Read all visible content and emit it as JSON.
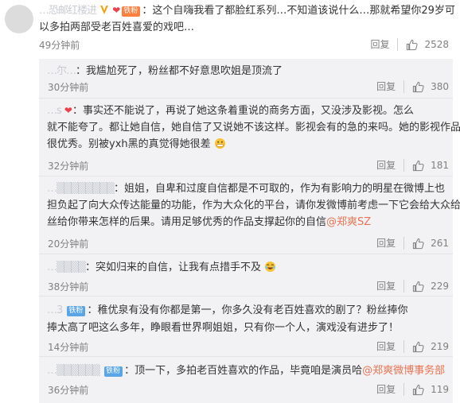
{
  "main_comment": {
    "username": "…恐邮红楼进",
    "badge": "铁粉",
    "text_lines": [
      "：这个自嗨我看了都脸红系列…不知道该说什么…那就希望你29岁可",
      "以多拍两部受老百姓喜爱的戏吧…"
    ],
    "time": "49分钟前",
    "reply_label": "回复",
    "likes": "2528"
  },
  "replies": [
    {
      "username": "…尔…",
      "badge": "",
      "lines": [
        "：我尴尬死了，粉丝都不好意思吹姐是顶流了"
      ],
      "time": "30分钟前",
      "reply_label": "回复",
      "likes": "380"
    },
    {
      "username": "…s",
      "badge": "heart",
      "lines": [
        "：事实还不能说了，再说了她这条着重说的商务方面，又没涉及影视。怎么",
        "就不能夸了。都让她自信，她自信了又说她不该这样。影视会有的急的来吗。她的影视作品也",
        "很优秀。别被yxh黑的真觉得她很差"
      ],
      "time": "32分钟前",
      "reply_label": "回复",
      "likes": "181"
    },
    {
      "username": "…",
      "badge": "",
      "lines": [
        "：姐姐，自卑和过度自信都是不可取的，作为有影响力的明星在微博上也",
        "担负起了向大众传达能量的功能，作为大众化的平台，请你发微博前考虑一下它会给大众给粉",
        "丝给你带来怎样的后果。请用足够优秀的作品支撑起你的自信"
      ],
      "mention": "@郑爽SZ",
      "time": "20分钟前",
      "reply_label": "回复",
      "likes": "261"
    },
    {
      "username": "…",
      "badge": "",
      "lines": [
        "：突如归来的自信，让我有点措手不及"
      ],
      "time": "38分钟前",
      "reply_label": "回复",
      "likes": "229"
    },
    {
      "username": "…3",
      "badge": "铁粉",
      "lines": [
        "：稚优泉有没有你都是第一，你多久没有老百姓喜欢的剧了？粉丝捧你",
        "捧太高了吧这么多年，睁眼看世界啊姐姐，只有你一个人，演戏没有进步了！"
      ],
      "time": "14分钟前",
      "reply_label": "回复",
      "likes": "219"
    },
    {
      "username": "…",
      "badge": "铁粉",
      "lines": [
        "：顶一下，多拍老百姓喜欢的作品，毕竟咱是演员哈"
      ],
      "mention": "@郑爽微博事务部",
      "time": "36分钟前",
      "reply_label": "回复",
      "likes": "119"
    }
  ],
  "colors": {
    "link": "#eb7350",
    "reply_bg": "#f2f2f5",
    "muted": "#808080"
  },
  "icons": {
    "like": "thumbs-up-icon",
    "verified": "v-verified-icon"
  }
}
